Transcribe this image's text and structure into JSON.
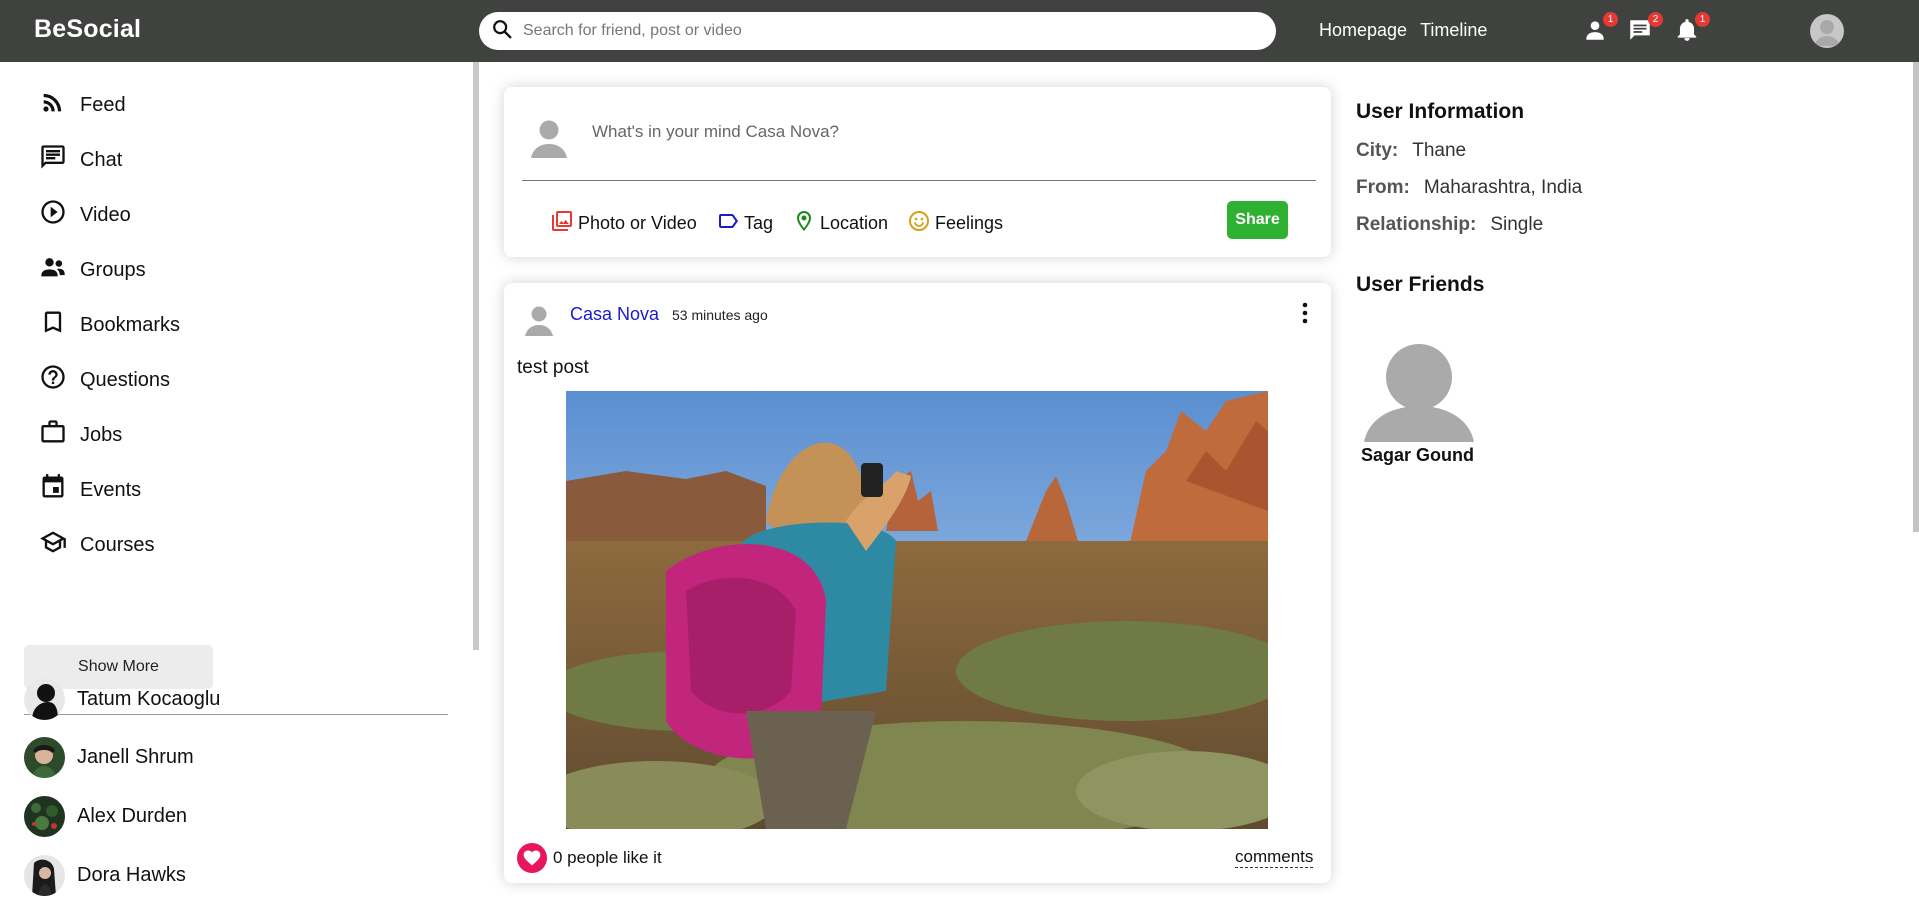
{
  "app": {
    "title": "BeSocial"
  },
  "search": {
    "placeholder": "Search for friend, post or video"
  },
  "topnav": {
    "links": [
      "Homepage",
      "Timeline"
    ],
    "icons": [
      {
        "name": "person-icon",
        "badge": "1"
      },
      {
        "name": "chat-icon",
        "badge": "2"
      },
      {
        "name": "notifications-icon",
        "badge": "1"
      }
    ]
  },
  "sidebar": {
    "items": [
      {
        "label": "Feed",
        "icon": "rss-feed-icon"
      },
      {
        "label": "Chat",
        "icon": "chat-icon"
      },
      {
        "label": "Video",
        "icon": "play-circle-icon"
      },
      {
        "label": "Groups",
        "icon": "group-icon"
      },
      {
        "label": "Bookmarks",
        "icon": "bookmark-icon"
      },
      {
        "label": "Questions",
        "icon": "help-circle-icon"
      },
      {
        "label": "Jobs",
        "icon": "briefcase-icon"
      },
      {
        "label": "Events",
        "icon": "calendar-icon"
      },
      {
        "label": "Courses",
        "icon": "school-icon"
      }
    ],
    "show_more": "Show More",
    "friends": [
      {
        "name": "Tatum Kocaoglu"
      },
      {
        "name": "Janell Shrum"
      },
      {
        "name": "Alex Durden"
      },
      {
        "name": "Dora Hawks"
      }
    ]
  },
  "share": {
    "placeholder": "What's in your mind Casa Nova?",
    "options": [
      {
        "label": "Photo or Video",
        "icon": "photo-library-icon",
        "color": "#e53935"
      },
      {
        "label": "Tag",
        "icon": "label-icon",
        "color": "#1a1acf"
      },
      {
        "label": "Location",
        "icon": "location-pin-icon",
        "color": "#1b8a1b"
      },
      {
        "label": "Feelings",
        "icon": "emoji-icon",
        "color": "#d4a017"
      }
    ],
    "button": "Share",
    "button_color": "#2eb131"
  },
  "post": {
    "author": "Casa Nova",
    "time": "53 minutes ago",
    "text": "test post",
    "likes": "0 people like it",
    "comments": "comments",
    "like_color": "#e8175d"
  },
  "right": {
    "info_title": "User Information",
    "info": [
      {
        "key": "City:",
        "value": "Thane"
      },
      {
        "key": "From:",
        "value": "Maharashtra, India"
      },
      {
        "key": "Relationship:",
        "value": "Single"
      }
    ],
    "friends_title": "User Friends",
    "friends": [
      {
        "name": "Sagar Gound"
      }
    ]
  },
  "colors": {
    "topbar": "#3f423e",
    "author_link": "#1a1acf"
  }
}
